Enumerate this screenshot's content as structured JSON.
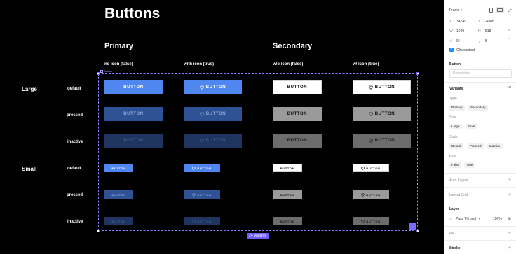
{
  "canvas": {
    "title": "Buttons",
    "groups": {
      "primary": "Primary",
      "secondary": "Secondary"
    },
    "columns": [
      "no icon (false)",
      "with icon (true)",
      "w/o icon (false)",
      "w/ icon (true)"
    ],
    "sizes": {
      "large": "Large",
      "small": "Small"
    },
    "states": [
      "default",
      "pressed",
      "inactive",
      "default",
      "pressed",
      "inactive"
    ],
    "button_label": "BUTTON",
    "frame_name": "Button",
    "variants_badge": "24 Variants"
  },
  "colors": {
    "primary_default": "#4f86f0",
    "primary_pressed": "#2f5294",
    "primary_inactive": "#1f345e",
    "secondary_default": "#ffffff",
    "secondary_pressed": "#9a9a9a",
    "secondary_inactive": "#6c6c6c",
    "selection": "#6d5ef8"
  },
  "panel": {
    "frame_label": "Frame",
    "x_label": "X",
    "x_value": "34749",
    "y_label": "Y",
    "y_value": "-4988",
    "w_label": "W",
    "w_value": "1049",
    "h_label": "H",
    "h_value": "518",
    "rotation": "0°",
    "radius": "5",
    "clip_content": "Clip content",
    "component_title": "Button",
    "description_placeholder": "Description",
    "variants_title": "Variants",
    "properties": [
      {
        "name": "Type",
        "values": [
          "Primary",
          "Secondary"
        ]
      },
      {
        "name": "Size",
        "values": [
          "Large",
          "Small"
        ]
      },
      {
        "name": "State",
        "values": [
          "Default",
          "Pressed",
          "Inactive"
        ]
      },
      {
        "name": "Icon",
        "values": [
          "False",
          "True"
        ]
      }
    ],
    "auto_layout": "Auto Layout",
    "layout_grid": "Layout Grid",
    "layer_title": "Layer",
    "blend_mode": "Pass Through",
    "opacity": "100%",
    "fill_title": "Fill",
    "stroke_title": "Stroke"
  }
}
